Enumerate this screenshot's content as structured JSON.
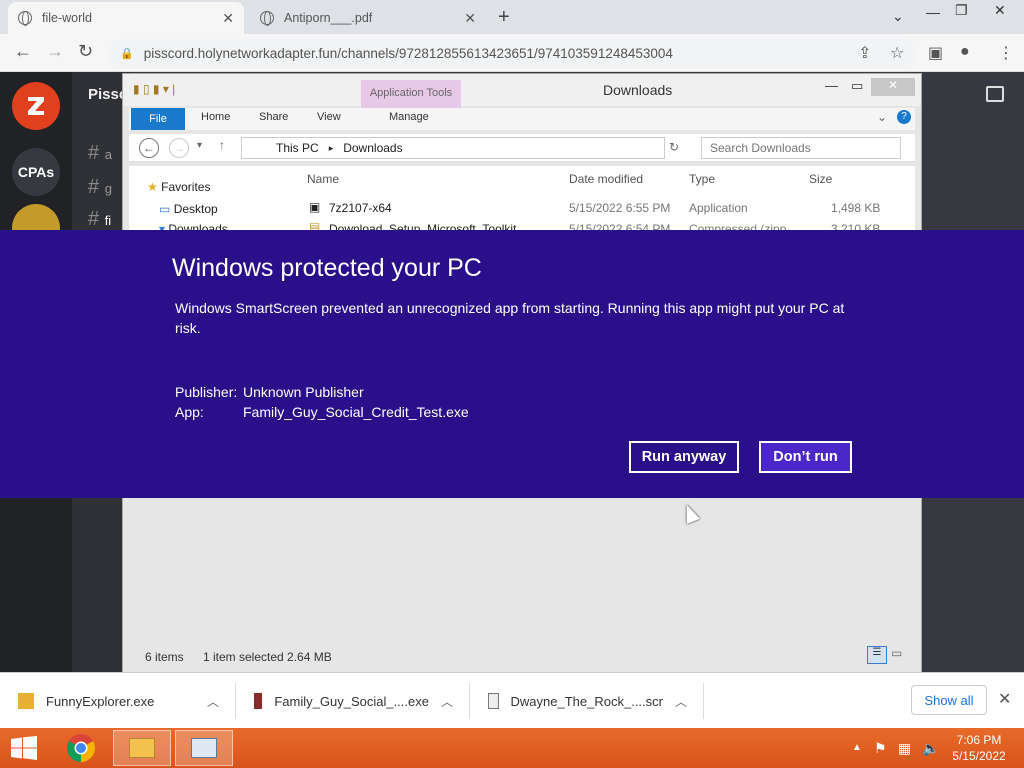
{
  "browser": {
    "tabs": [
      {
        "label": "file-world",
        "active": true
      },
      {
        "label": "Antiporn___.pdf",
        "active": false
      }
    ],
    "url": "pisscord.holynetworkadapter.fun/channels/972812855613423651/974103591248453004"
  },
  "discord": {
    "server_name": "Pissc",
    "guild_labels": [
      "CPAs"
    ],
    "channel_prefixes": [
      "a",
      "g",
      "fi"
    ]
  },
  "explorer": {
    "title": "Downloads",
    "context_tab": "Application Tools",
    "ribbon_tabs": [
      "File",
      "Home",
      "Share",
      "View",
      "Manage"
    ],
    "breadcrumb": [
      "This PC",
      "Downloads"
    ],
    "search_placeholder": "Search Downloads",
    "nav": [
      "Favorites",
      "Desktop",
      "Downloads"
    ],
    "columns": [
      "Name",
      "Date modified",
      "Type",
      "Size"
    ],
    "files": [
      {
        "name": "7z2107-x64",
        "date": "5/15/2022 6:55 PM",
        "type": "Application",
        "size": "1,498 KB"
      },
      {
        "name": "Download_Setup_Microsoft_Toolkit",
        "date": "5/15/2022 6:54 PM",
        "type": "Compressed (zipp...",
        "size": "3,210 KB"
      }
    ],
    "status": {
      "items": "6 items",
      "selected": "1 item selected  2.64 MB"
    }
  },
  "smartscreen": {
    "title": "Windows protected your PC",
    "message": "Windows SmartScreen prevented an unrecognized app from starting. Running this app might put your PC at risk.",
    "publisher_label": "Publisher:",
    "publisher_value": "Unknown Publisher",
    "app_label": "App:",
    "app_value": "Family_Guy_Social_Credit_Test.exe",
    "run_label": "Run anyway",
    "dont_label": "Don’t run",
    "bg_color": "#2a0f8a"
  },
  "downloads": {
    "items": [
      "FunnyExplorer.exe",
      "Family_Guy_Social_....exe",
      "Dwayne_The_Rock_....scr"
    ],
    "show_all": "Show all"
  },
  "taskbar": {
    "time": "7:06 PM",
    "date": "5/15/2022"
  }
}
